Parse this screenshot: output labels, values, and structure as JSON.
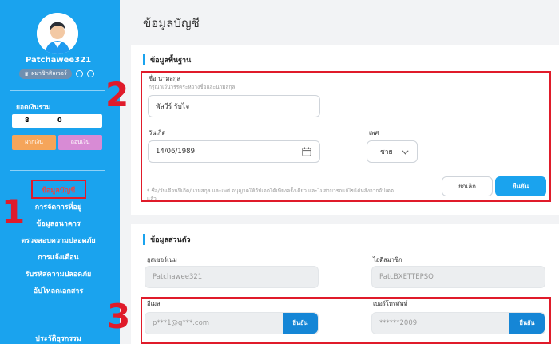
{
  "sidebar": {
    "username": "Patchawee321",
    "badge_label": "ผมาชิกสิลเวอร์",
    "balance_label": "ยอดเงินรวม",
    "balance_value_1": "8",
    "balance_value_2": "0",
    "deposit_label": "ฝากเงิน",
    "withdraw_label": "ถอนเงิน",
    "menu": [
      {
        "label": "ข้อมูลบัญชี"
      },
      {
        "label": "การจัดการที่อยู่"
      },
      {
        "label": "ข้อมูลธนาคาร"
      },
      {
        "label": "ตรวจสอบความปลอดภัย"
      },
      {
        "label": "การแจ้งเตือน"
      },
      {
        "label": "รับรหัสความปลอดภัย"
      },
      {
        "label": "อัปโหลดเอกสาร"
      }
    ],
    "history_label": "ประวัติธุรกรรม"
  },
  "main": {
    "page_title": "ข้อมูลบัญชี",
    "basic": {
      "section_title": "ข้อมูลพื้นฐาน",
      "name_label": "ชื่อ นามสกุล",
      "name_hint": "กรุณาเว้นวรรคระหว่างชื่อและนามสกุล",
      "name_value": "พัสวีร์ รับไจ",
      "dob_label": "วันเกิด",
      "dob_value": "14/06/1989",
      "gender_label": "เพศ",
      "gender_value": "ชาย",
      "note": "* ชื่อ/วันเดือนปีเกิด/นามสกุล และเพศ อนุญาตให้อัปเดตได้เพียงครั้งเดียว และไม่สามารถแก้ไขได้หลังจากอัปเดตแล้ว",
      "cancel_label": "ยกเลิก",
      "confirm_label": "ยืนยัน"
    },
    "personal": {
      "section_title": "ข้อมูลส่วนตัว",
      "username_label": "ยูสเซอร์เนม",
      "username_value": "Patchawee321",
      "member_id_label": "ไอดีสมาชิก",
      "member_id_value": "PatcBXETTEPSQ",
      "email_label": "อีเมล",
      "email_value": "p***1@g***.com",
      "email_confirm": "ยืนยัน",
      "phone_label": "เบอร์โทรศัพท์",
      "phone_value": "******2009",
      "phone_confirm": "ยืนยัน"
    }
  },
  "annotations": [
    "1",
    "2",
    "3"
  ],
  "colors": {
    "accent": "#1aa3ee",
    "annotation": "#e01b2a",
    "active_menu": "#e84545"
  }
}
